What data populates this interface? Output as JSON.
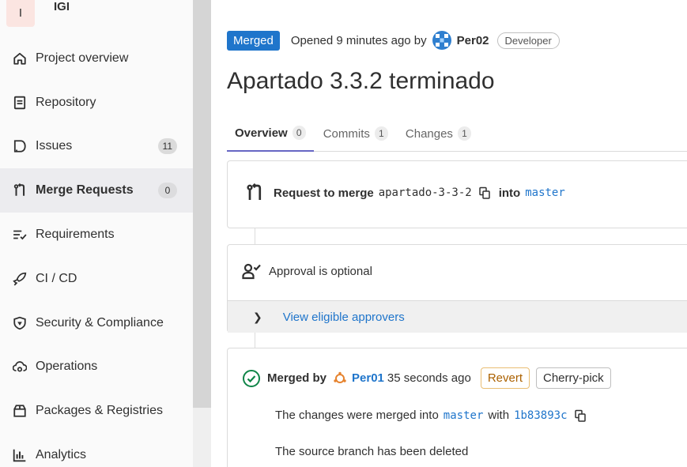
{
  "sidebar": {
    "project_initial": "I",
    "project_name": "IGI",
    "items": [
      {
        "label": "Project overview",
        "icon": "home-icon"
      },
      {
        "label": "Repository",
        "icon": "document-icon"
      },
      {
        "label": "Issues",
        "icon": "issues-icon",
        "badge": "11"
      },
      {
        "label": "Merge Requests",
        "icon": "git-merge-icon",
        "badge": "0",
        "active": true
      },
      {
        "label": "Requirements",
        "icon": "requirements-icon"
      },
      {
        "label": "CI / CD",
        "icon": "rocket-icon"
      },
      {
        "label": "Security & Compliance",
        "icon": "shield-icon"
      },
      {
        "label": "Operations",
        "icon": "cloud-gear-icon"
      },
      {
        "label": "Packages & Registries",
        "icon": "package-icon"
      },
      {
        "label": "Analytics",
        "icon": "chart-icon"
      }
    ]
  },
  "mr": {
    "status": "Merged",
    "opened_text": "Opened 9 minutes ago by",
    "author": "Per02",
    "author_role": "Developer",
    "title": "Apartado 3.3.2 terminado",
    "tabs": [
      {
        "label": "Overview",
        "count": "0"
      },
      {
        "label": "Commits",
        "count": "1"
      },
      {
        "label": "Changes",
        "count": "1"
      }
    ],
    "request_label": "Request to merge",
    "source_branch": "apartado-3-3-2",
    "into_label": "into",
    "target_branch": "master",
    "approval_text": "Approval is optional",
    "eligible_link": "View eligible approvers",
    "merged_by_label": "Merged by",
    "merged_by": "Per01",
    "merged_ago": "35 seconds ago",
    "revert_label": "Revert",
    "cherry_label": "Cherry-pick",
    "merged_into_text": "The changes were merged into",
    "merged_into_branch": "master",
    "with_text": "with",
    "commit_sha": "1b83893c",
    "branch_deleted_text": "The source branch has been deleted"
  },
  "colors": {
    "accent": "#1f75cb",
    "active_tab_underline": "#6666c4",
    "success": "#108548",
    "revert": "#ab6100"
  }
}
